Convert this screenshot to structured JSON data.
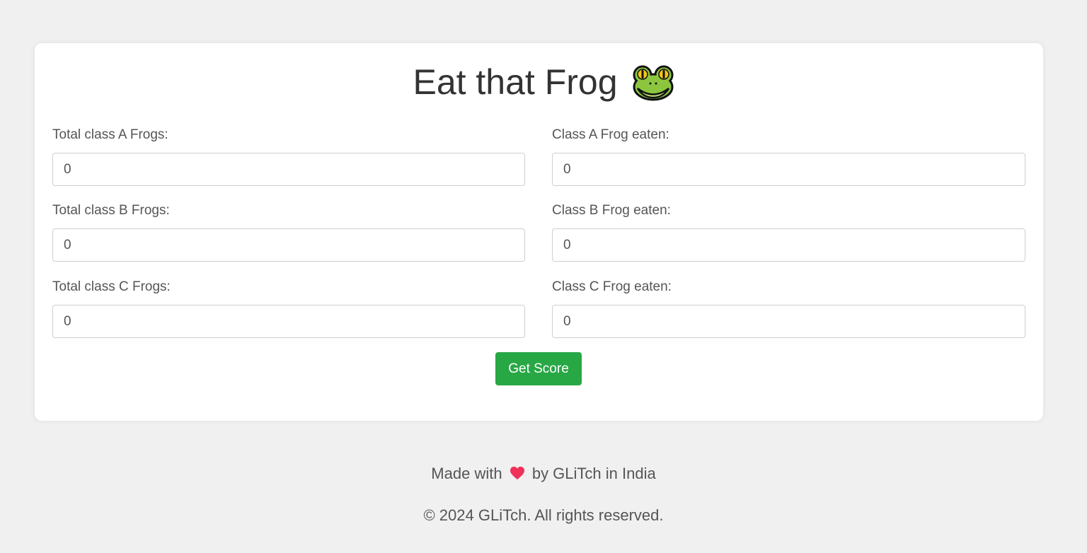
{
  "page": {
    "title": "Eat that Frog",
    "title_icon": "frog-icon"
  },
  "form": {
    "fields": [
      {
        "label": "Total class A Frogs:",
        "value": "0"
      },
      {
        "label": "Class A Frog eaten:",
        "value": "0"
      },
      {
        "label": "Total class B Frogs:",
        "value": "0"
      },
      {
        "label": "Class B Frog eaten:",
        "value": "0"
      },
      {
        "label": "Total class C Frogs:",
        "value": "0"
      },
      {
        "label": "Class C Frog eaten:",
        "value": "0"
      }
    ],
    "submit_label": "Get Score"
  },
  "footer": {
    "made_with_prefix": "Made with",
    "made_with_icon": "heart-icon",
    "made_with_suffix": "by GLiTch in India",
    "copyright": "© 2024 GLiTch. All rights reserved."
  },
  "colors": {
    "background": "#f0f0f0",
    "card": "#ffffff",
    "button": "#28a745",
    "heart": "#f0325a",
    "frog_green": "#8cc63f"
  }
}
